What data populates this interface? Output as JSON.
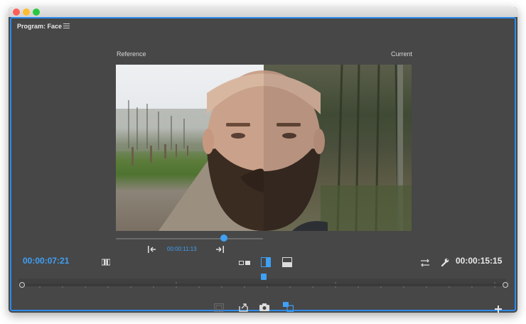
{
  "panel": {
    "title": "Program: Face"
  },
  "viewer": {
    "reference_label": "Reference",
    "current_label": "Current"
  },
  "timecodes": {
    "playhead": "00:00:07:21",
    "comparison": "00:00:11:13",
    "duration": "00:00:15:15"
  },
  "colors": {
    "accent": "#3fa0f5",
    "panel_bg": "#474747",
    "border": "#2d8ceb",
    "text": "#e8e8e8"
  },
  "icons": {
    "menu": "hamburger-menu-icon",
    "go_to_in": "go-to-in-point-icon",
    "go_to_out": "go-to-out-point-icon",
    "side_by_side": "side-by-side-icon",
    "vertical_split": "vertical-split-icon",
    "horizontal_split": "horizontal-split-icon",
    "swap": "swap-sides-icon",
    "settings": "wrench-icon",
    "safe_margins": "safe-margins-icon",
    "export": "export-frame-icon",
    "camera": "camera-icon",
    "compare": "comparison-view-icon",
    "add": "plus-icon"
  }
}
